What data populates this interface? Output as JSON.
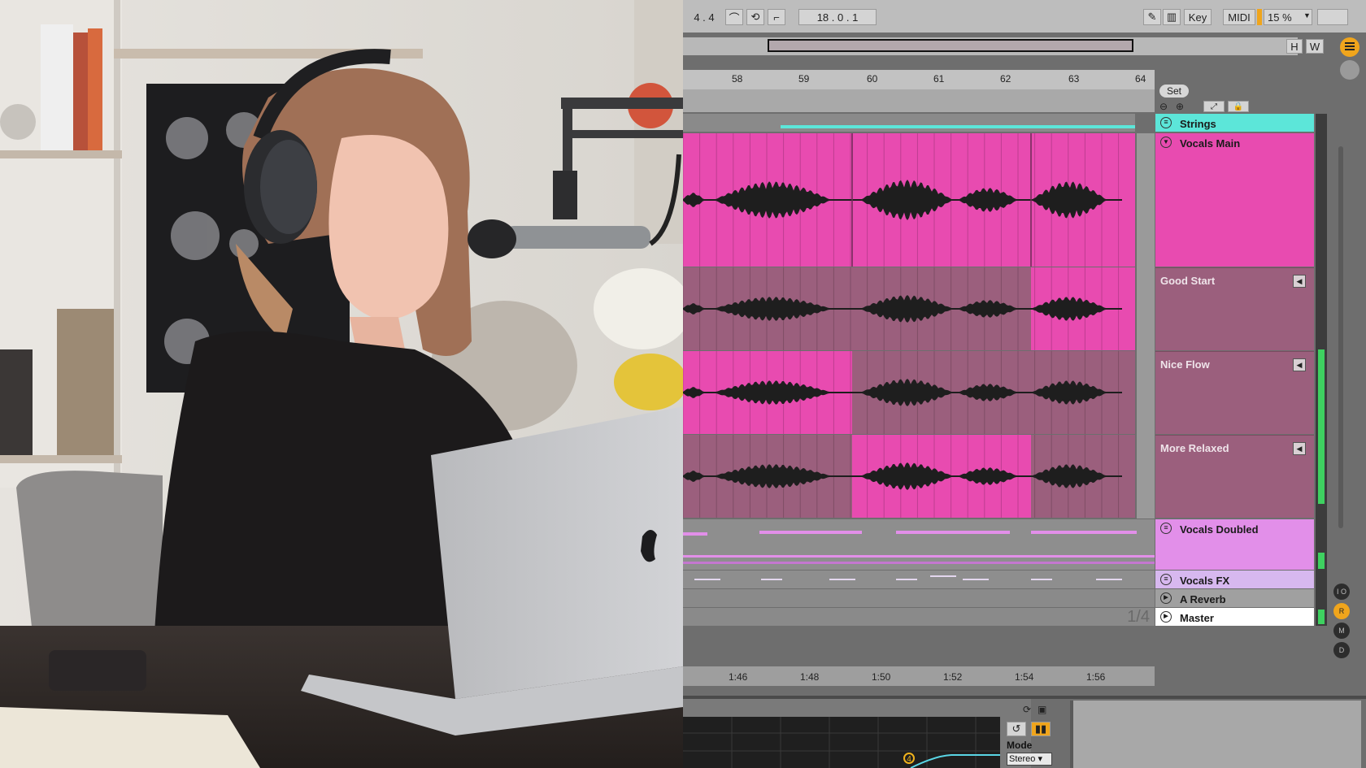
{
  "transport": {
    "time_signature": "4 . 4",
    "position": "18 .  0 .  1",
    "key_label": "Key",
    "midi_label": "MIDI",
    "zoom": "15 %",
    "h_label": "H",
    "w_label": "W"
  },
  "ruler": {
    "bars": [
      "58",
      "59",
      "60",
      "61",
      "62",
      "63",
      "64"
    ],
    "set_label": "Set"
  },
  "tracks": [
    {
      "name": "Strings",
      "color": "#5ce6d9"
    },
    {
      "name": "Vocals Main",
      "color": "#e84bb0"
    },
    {
      "name": "Vocals Doubled",
      "color": "#e28fe9"
    },
    {
      "name": "Vocals FX",
      "color": "#d7b8ef"
    },
    {
      "name": "A Reverb",
      "color": "#a0a0a0"
    },
    {
      "name": "Master",
      "color": "#ffffff"
    }
  ],
  "takes": [
    {
      "name": "Good Start"
    },
    {
      "name": "Nice Flow"
    },
    {
      "name": "More Relaxed"
    }
  ],
  "grid_label": "1/4",
  "time_ruler": [
    "1:46",
    "1:48",
    "1:50",
    "1:52",
    "1:54",
    "1:56"
  ],
  "side_buttons": [
    "I O",
    "R",
    "M",
    "D"
  ],
  "device": {
    "mode_label": "Mode",
    "mode_value": "Stereo ▾",
    "band_number": "4"
  },
  "colors": {
    "pink": "#e84bb0",
    "take_bg": "#9b5f7d",
    "waveform": "#1e1e1e"
  }
}
